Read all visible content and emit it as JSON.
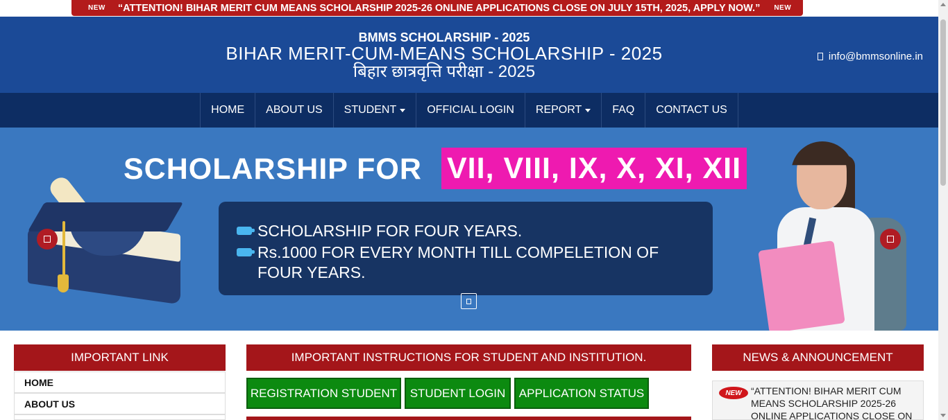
{
  "ticker": {
    "new_left": "NEW",
    "text": "“ATTENTION! BIHAR MERIT CUM MEANS SCHOLARSHIP 2025-26 ONLINE APPLICATIONS CLOSE ON JULY 15TH, 2025, APPLY NOW.”",
    "new_right": "NEW"
  },
  "header": {
    "small_title": "BMMS SCHOLARSHIP - 2025",
    "big_title": "BIHAR MERIT-CUM-MEANS SCHOLARSHIP - 2025",
    "hindi_title": "बिहार छात्रवृत्ति परीक्षा - 2025",
    "email": "info@bmmsonline.in",
    "email_icon": "envelope-icon"
  },
  "nav": {
    "home": "HOME",
    "about": "ABOUT US",
    "student": "STUDENT",
    "official_login": "OFFICIAL LOGIN",
    "report": "REPORT",
    "faq": "FAQ",
    "contact": "CONTACT US"
  },
  "banner": {
    "title": "SCHOLARSHIP FOR",
    "highlight": "VII, VIII, IX, X, XI, XII",
    "line1": "SCHOLARSHIP FOR FOUR YEARS.",
    "line2": "Rs.1000 FOR EVERY MONTH TILL COMPELETION OF FOUR YEARS.",
    "prev_icon": "chevron-left-icon",
    "next_icon": "chevron-right-icon"
  },
  "important_link": {
    "heading": "IMPORTANT LINK",
    "items": [
      "HOME",
      "ABOUT US"
    ]
  },
  "instructions": {
    "heading": "IMPORTANT INSTRUCTIONS FOR STUDENT AND INSTITUTION.",
    "registration": "REGISTRATION STUDENT",
    "login": "STUDENT LOGIN",
    "status": "APPLICATION STATUS"
  },
  "news": {
    "heading": "NEWS & ANNOUNCEMENT",
    "badge": "NEW",
    "text": "“ATTENTION! BIHAR MERIT CUM MEANS SCHOLARSHIP 2025-26 ONLINE APPLICATIONS CLOSE ON"
  },
  "colors": {
    "header_blue": "#1b4a97",
    "nav_navy": "#0d2d63",
    "accent_red": "#a4161a",
    "button_green": "#0c8a10",
    "highlight_magenta": "#ee1ab0"
  }
}
